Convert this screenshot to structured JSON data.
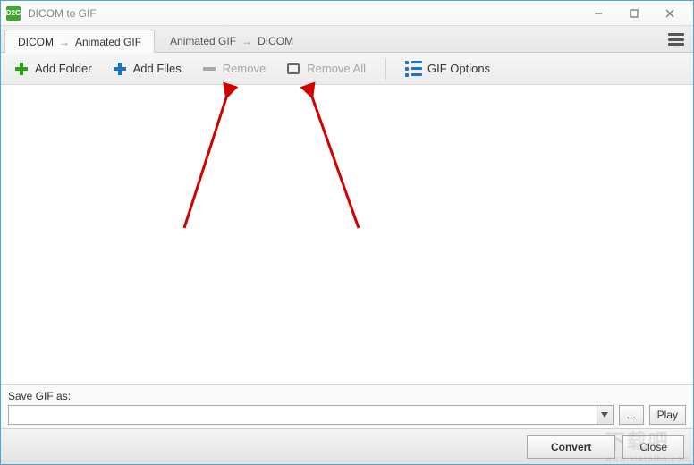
{
  "window": {
    "title": "DICOM to GIF",
    "icon_label": "D2G"
  },
  "tabs": {
    "tab1_left": "DICOM",
    "tab1_right": "Animated GIF",
    "tab2_left": "Animated GIF",
    "tab2_right": "DICOM",
    "arrow": "→"
  },
  "toolbar": {
    "add_folder": "Add Folder",
    "add_files": "Add Files",
    "remove": "Remove",
    "remove_all": "Remove All",
    "gif_options": "GIF Options"
  },
  "save": {
    "label": "Save GIF as:",
    "value": "",
    "browse": "...",
    "play": "Play"
  },
  "footer": {
    "convert": "Convert",
    "close": "Close"
  },
  "watermark": {
    "text": "下载吧",
    "url": "www.xiazaiba.com"
  }
}
